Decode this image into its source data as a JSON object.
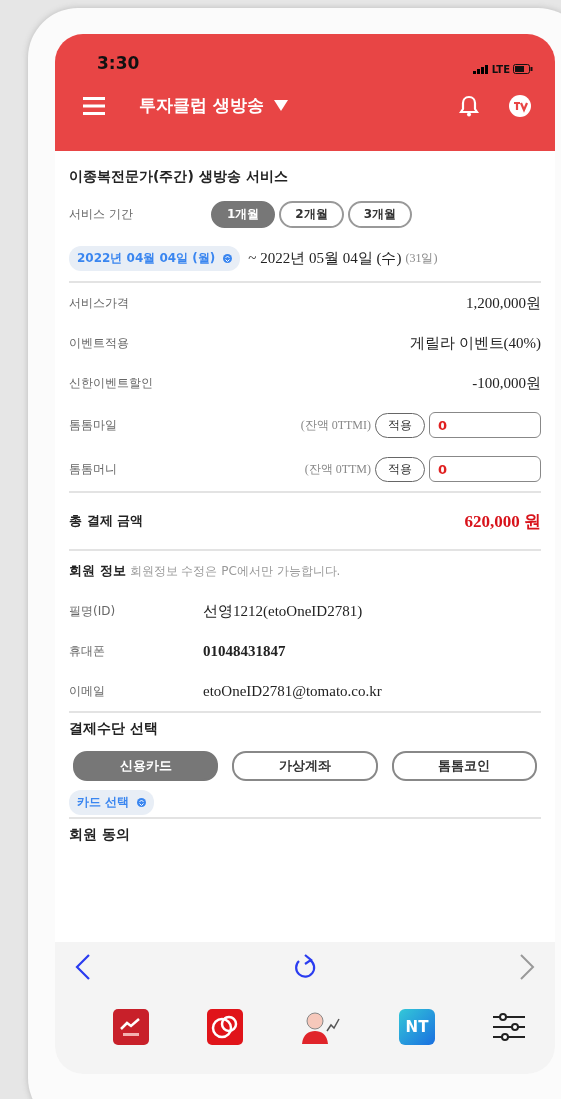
{
  "status_bar": {
    "time": "3:30",
    "network": "LTE"
  },
  "header": {
    "title": "투자클럽 생방송"
  },
  "service": {
    "title": "이종복전문가(주간) 생방송 서비스",
    "period_label": "서비스 기간",
    "periods": [
      {
        "label": "1개월",
        "selected": true
      },
      {
        "label": "2개월",
        "selected": false
      },
      {
        "label": "3개월",
        "selected": false
      }
    ],
    "start_date": "2022년 04월 04일 (월)",
    "end_date": "~ 2022년 05월 04일 (수)",
    "days": "(31일)"
  },
  "prices": [
    {
      "kind": "text",
      "label": "서비스가격",
      "value": "1,200,000원"
    },
    {
      "kind": "text",
      "label": "이벤트적용",
      "value": "게릴라 이벤트(40%)"
    },
    {
      "kind": "text",
      "label": "신한이벤트할인",
      "value": "-100,000원"
    },
    {
      "kind": "points",
      "label": "톰톰마일",
      "balance": "(잔액 0TTMI)",
      "button": "적용",
      "value": "0"
    },
    {
      "kind": "points",
      "label": "톰톰머니",
      "balance": "(잔액 0TTM)",
      "button": "적용",
      "value": "0"
    }
  ],
  "total": {
    "label": "총 결제 금액",
    "value": "620,000 원"
  },
  "member": {
    "title": "회원 정보",
    "note": "회원정보 수정은 PC에서만 가능합니다.",
    "rows": [
      {
        "label": "필명(ID)",
        "value": "선영1212(etoOneID2781)",
        "bold": false
      },
      {
        "label": "휴대폰",
        "value": "01048431847",
        "bold": true
      },
      {
        "label": "이메일",
        "value": "etoOneID2781@tomato.co.kr",
        "bold": false
      }
    ]
  },
  "payment": {
    "title": "결제수단 선택",
    "methods": [
      {
        "label": "신용카드",
        "selected": true
      },
      {
        "label": "가상계좌",
        "selected": false
      },
      {
        "label": "톰톰코인",
        "selected": false
      }
    ],
    "card_select": "카드 선택"
  },
  "consent": {
    "title": "회원 동의"
  },
  "dock": {
    "nt_label": "NT"
  }
}
